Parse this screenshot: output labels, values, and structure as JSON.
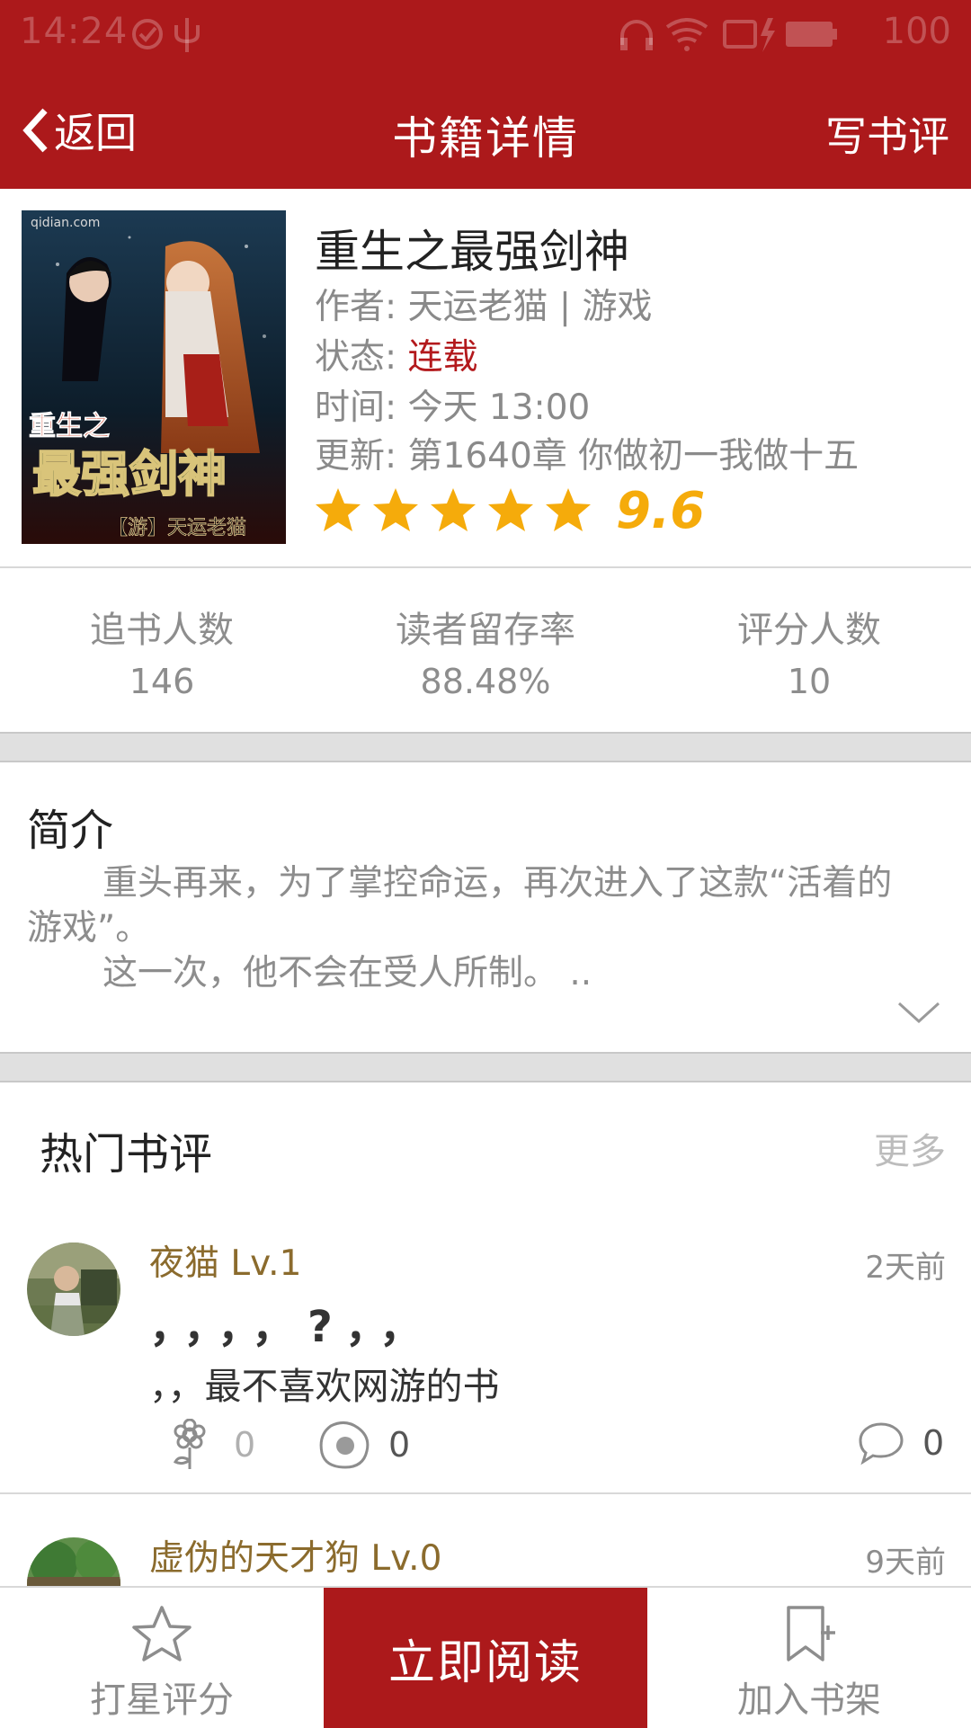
{
  "status_bar": {
    "time": "14:24",
    "battery": "100"
  },
  "nav": {
    "back_label": "返回",
    "title": "书籍详情",
    "action_label": "写书评"
  },
  "book": {
    "title": "重生之最强剑神",
    "author_line": "作者: 天运老猫 | 游戏",
    "status_label": "状态: ",
    "status_value": "连载",
    "time_line": "时间: 今天 13:00",
    "update_line": "更新: 第1640章 你做初一我做十五",
    "stars": 5,
    "rating": "9.6",
    "cover": {
      "site_text": "qidian.com",
      "title_top": "重生之",
      "title_main": "最强剑神",
      "author_tag": "【游】天运老猫"
    }
  },
  "stats": [
    {
      "label": "追书人数",
      "value": "146"
    },
    {
      "label": "读者留存率",
      "value": "88.48%"
    },
    {
      "label": "评分人数",
      "value": "10"
    }
  ],
  "intro": {
    "title": "简介",
    "lines": [
      "重头再来，为了掌控命运，再次进入了这款“活着的游戏”。",
      "这一次，他不会在受人所制。 .."
    ]
  },
  "reviews": {
    "title": "热门书评",
    "more_label": "更多",
    "items": [
      {
        "username": "夜猫 Lv.1",
        "time": "2天前",
        "line1": "，，，，?，，",
        "line2": "，，最不喜欢网游的书",
        "flower_count": "0",
        "egg_count": "0",
        "comment_count": "0"
      },
      {
        "username": "虚伪的天才狗 Lv.0",
        "time": "9天前"
      }
    ]
  },
  "bottom_bar": {
    "rate_label": "打星评分",
    "read_label": "立即阅读",
    "shelf_label": "加入书架"
  },
  "colors": {
    "brand": "#ac191b",
    "star": "#f5ab0b",
    "username": "#8b6b2d",
    "status": "#b3191c"
  }
}
